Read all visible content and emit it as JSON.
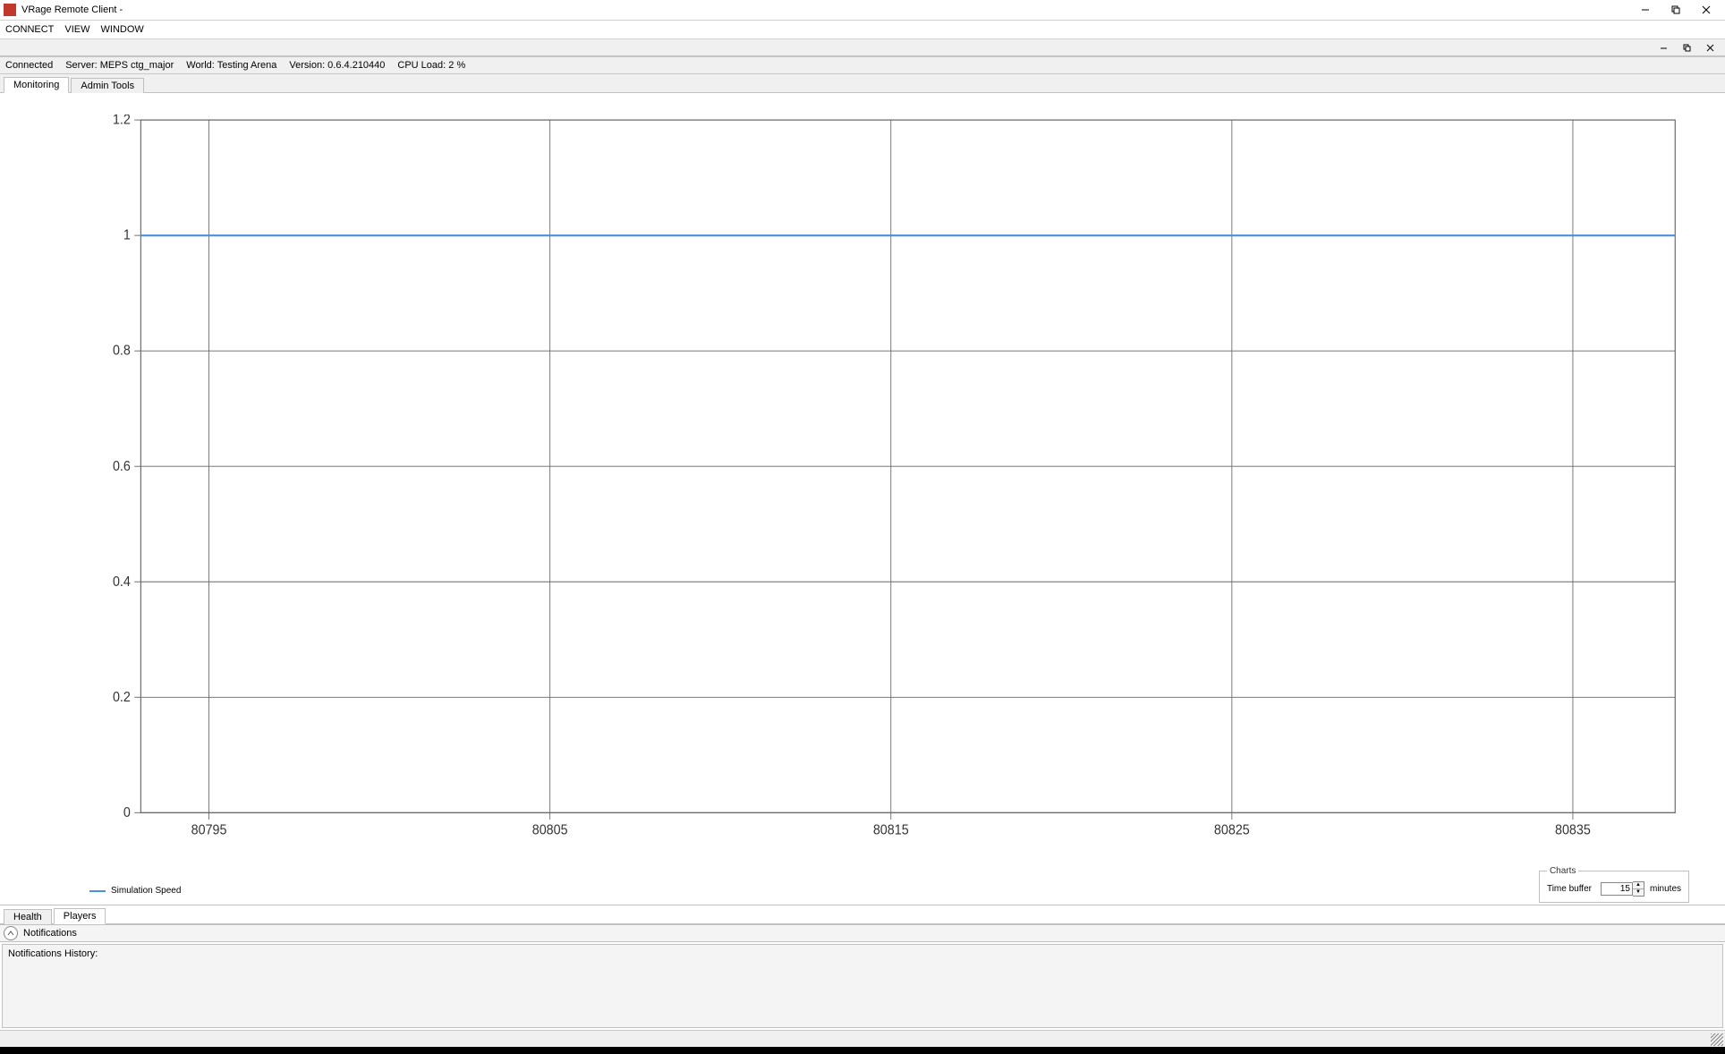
{
  "window": {
    "title": "VRage Remote Client -"
  },
  "menus": {
    "connect": "CONNECT",
    "view": "VIEW",
    "window": "WINDOW"
  },
  "status": {
    "connected": "Connected",
    "server_label": "Server: MEPS ctg_major",
    "world_label": "World: Testing Arena",
    "version_label": "Version: 0.6.4.210440",
    "cpu_label": "CPU Load: 2 %"
  },
  "tabs_top": {
    "monitoring": "Monitoring",
    "admin_tools": "Admin Tools"
  },
  "tabs_bottom": {
    "health": "Health",
    "players": "Players"
  },
  "legend": {
    "series1": "Simulation Speed"
  },
  "charts_panel": {
    "group": "Charts",
    "time_buffer_label": "Time buffer",
    "time_buffer_value": "15",
    "minutes": "minutes"
  },
  "notifications": {
    "header": "Notifications",
    "history_label": "Notifications History:"
  },
  "chart_data": {
    "type": "line",
    "series": [
      {
        "name": "Simulation Speed",
        "color": "#4a90e2",
        "x": [
          80793,
          80795,
          80800,
          80805,
          80810,
          80815,
          80820,
          80825,
          80830,
          80835,
          80838
        ],
        "y": [
          1.0,
          1.0,
          1.0,
          1.0,
          1.0,
          1.0,
          1.0,
          1.0,
          1.0,
          1.0,
          1.0
        ]
      }
    ],
    "xlim": [
      80793,
      80838
    ],
    "ylim": [
      0,
      1.2
    ],
    "xticks": [
      80795,
      80805,
      80815,
      80825,
      80835
    ],
    "yticks": [
      0,
      0.2,
      0.4,
      0.6,
      0.8,
      1,
      1.2
    ],
    "xlabel": "",
    "ylabel": ""
  }
}
